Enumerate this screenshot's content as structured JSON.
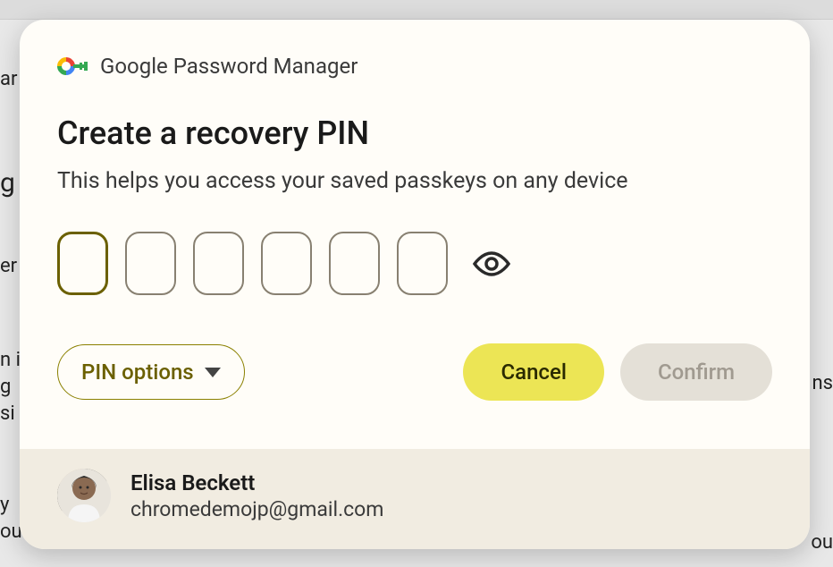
{
  "header": {
    "app_name": "Google Password Manager"
  },
  "dialog": {
    "title": "Create a recovery PIN",
    "subtitle": "This helps you access your saved passkeys on any device",
    "pin_length": 6,
    "active_index": 0
  },
  "actions": {
    "pin_options_label": "PIN options",
    "cancel_label": "Cancel",
    "confirm_label": "Confirm"
  },
  "user": {
    "name": "Elisa Beckett",
    "email": "chromedemojp@gmail.com"
  },
  "background": {
    "frag1": "ar",
    "frag2": "g",
    "frag3": "er",
    "frag4": "n i",
    "frag5": "g",
    "frag6": "si",
    "frag7": "ns",
    "frag8": "y",
    "frag9": "ou",
    "frag10": "ou"
  }
}
